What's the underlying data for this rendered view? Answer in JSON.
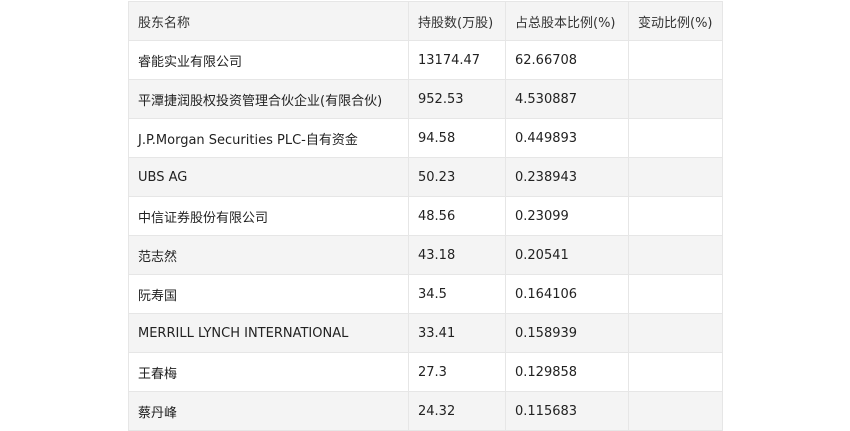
{
  "table": {
    "headers": [
      "股东名称",
      "持股数(万股)",
      "占总股本比例(%)",
      "变动比例(%)"
    ],
    "rows": [
      [
        "睿能实业有限公司",
        "13174.47",
        "62.66708",
        ""
      ],
      [
        "平潭捷润股权投资管理合伙企业(有限合伙)",
        "952.53",
        "4.530887",
        ""
      ],
      [
        "J.P.Morgan Securities PLC-自有资金",
        "94.58",
        "0.449893",
        ""
      ],
      [
        "UBS AG",
        "50.23",
        "0.238943",
        ""
      ],
      [
        "中信证券股份有限公司",
        "48.56",
        "0.23099",
        ""
      ],
      [
        "范志然",
        "43.18",
        "0.20541",
        ""
      ],
      [
        "阮寿国",
        "34.5",
        "0.164106",
        ""
      ],
      [
        "MERRILL LYNCH INTERNATIONAL",
        "33.41",
        "0.158939",
        ""
      ],
      [
        "王春梅",
        "27.3",
        "0.129858",
        ""
      ],
      [
        "蔡丹峰",
        "24.32",
        "0.115683",
        ""
      ]
    ]
  }
}
